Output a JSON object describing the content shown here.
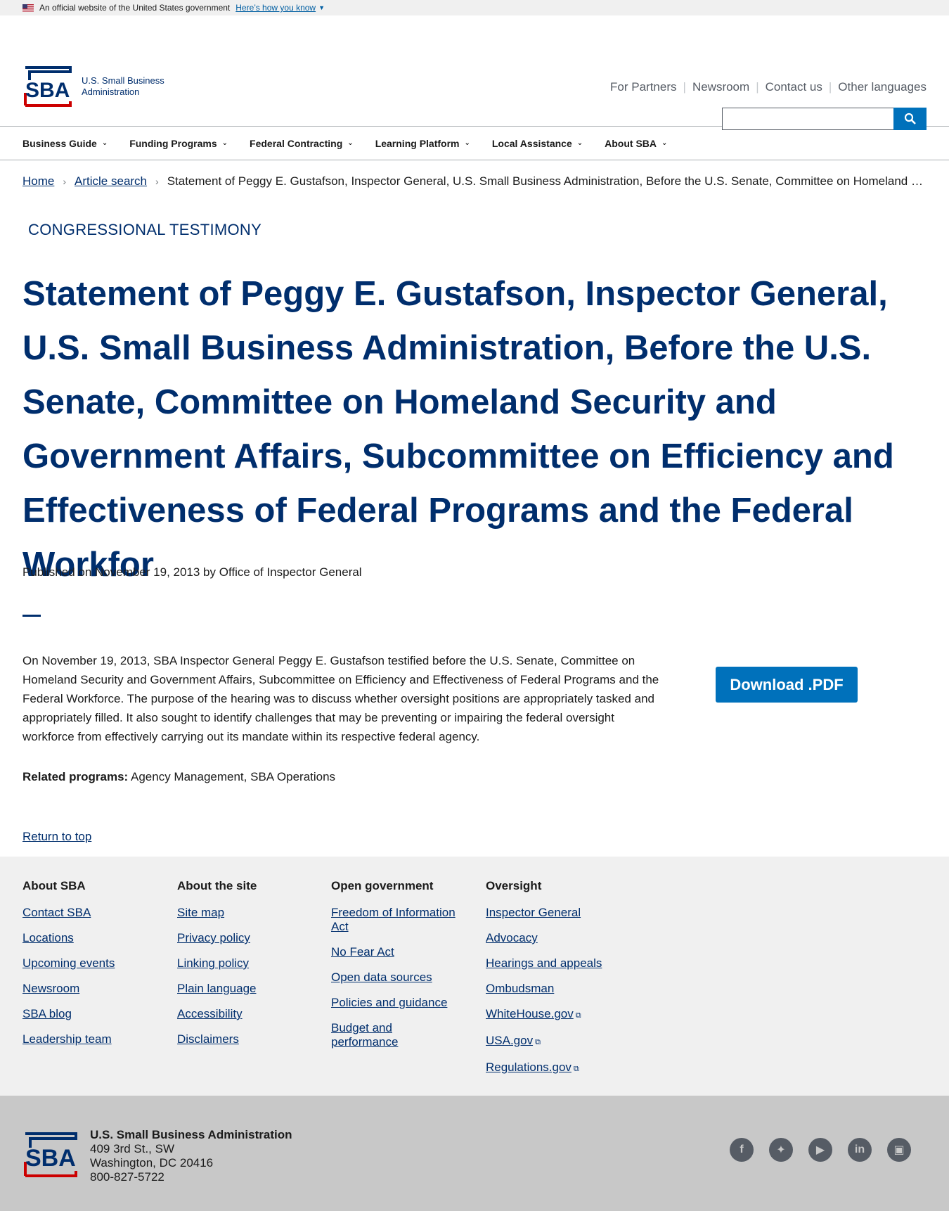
{
  "gov_banner": {
    "text": "An official website of the United States government",
    "link": "Here’s how you know"
  },
  "header": {
    "logo_line1": "U.S. Small Business",
    "logo_line2": "Administration",
    "logo_letters": "SBA",
    "utility_links": [
      "For Partners",
      "Newsroom",
      "Contact us",
      "Other languages"
    ],
    "search_placeholder": ""
  },
  "nav": [
    "Business Guide",
    "Funding Programs",
    "Federal Contracting",
    "Learning Platform",
    "Local Assistance",
    "About SBA"
  ],
  "breadcrumb": {
    "home": "Home",
    "article_search": "Article search",
    "current": "Statement of Peggy E. Gustafson, Inspector General, U.S. Small Business Administration, Before the U.S. Senate, Committee on Homeland Security and Government Affairs"
  },
  "article": {
    "kicker": "CONGRESSIONAL TESTIMONY",
    "title": "Statement of Peggy E. Gustafson, Inspector General, U.S. Small Business Administration, Before the U.S. Senate, Committee on Homeland Security and Government Affairs, Subcommittee on Efficiency and Effectiveness of Federal Programs and the Federal Workfor",
    "byline": "Published on November 19, 2013 by Office of Inspector General",
    "body": "On November 19, 2013, SBA Inspector General Peggy E. Gustafson testified before the U.S. Senate, Committee on Homeland Security and Government Affairs, Subcommittee on Efficiency and Effectiveness of Federal Programs and the Federal Workforce.  The purpose of the hearing was to discuss whether oversight positions are appropriately tasked and appropriately filled.  It also sought to identify challenges that may be preventing or impairing the federal oversight workforce from effectively carrying out its mandate within its respective federal agency.",
    "download_label": "Download .PDF",
    "related_label": "Related programs:",
    "related_value": "Agency Management, SBA Operations",
    "return_top": "Return to top"
  },
  "footer": {
    "columns": [
      {
        "heading": "About SBA",
        "links": [
          "Contact SBA",
          "Locations",
          "Upcoming events",
          "Newsroom",
          "SBA blog",
          "Leadership team"
        ]
      },
      {
        "heading": "About the site",
        "links": [
          "Site map",
          "Privacy policy",
          "Linking policy",
          "Plain language",
          "Accessibility",
          "Disclaimers"
        ]
      },
      {
        "heading": "Open government",
        "links": [
          "Freedom of Information Act",
          "No Fear Act",
          "Open data sources",
          "Policies and guidance",
          "Budget and performance"
        ]
      },
      {
        "heading": "Oversight",
        "links": [
          "Inspector General",
          "Advocacy",
          "Hearings and appeals",
          "Ombudsman",
          "WhiteHouse.gov",
          "USA.gov",
          "Regulations.gov"
        ]
      }
    ],
    "org_name": "U.S. Small Business Administration",
    "address1": "409 3rd St., SW",
    "address2": "Washington, DC 20416",
    "phone": "800-827-5722",
    "social_icons": [
      "facebook-icon",
      "twitter-icon",
      "youtube-icon",
      "linkedin-icon",
      "instagram-icon"
    ]
  },
  "colors": {
    "navy": "#002e6d",
    "accent_blue": "#0071bb",
    "red": "#cc0000"
  }
}
